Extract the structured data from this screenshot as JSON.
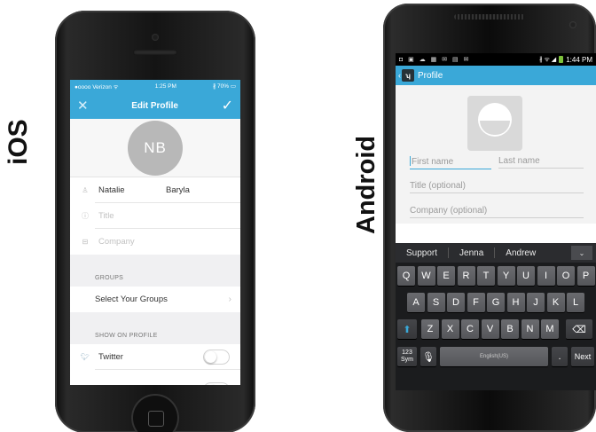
{
  "labels": {
    "ios": "iOS",
    "android": "Android"
  },
  "ios": {
    "status": {
      "carrier": "●oooo Verizon ᯤ",
      "time": "1:25 PM",
      "battery": "∦ 70% ▭"
    },
    "nav": {
      "title": "Edit Profile",
      "close_icon": "close-icon",
      "confirm_icon": "check-icon"
    },
    "avatar_initials": "NB",
    "fields": {
      "first_name": "Natalie",
      "last_name": "Baryla",
      "title_placeholder": "Title",
      "company_placeholder": "Company"
    },
    "groups": {
      "header": "GROUPS",
      "select_label": "Select Your Groups"
    },
    "show_on_profile": {
      "header": "SHOW ON PROFILE",
      "twitter_label": "Twitter",
      "twitter_enabled": false
    }
  },
  "android": {
    "status": {
      "left_icons": "◘ ▣ ☁ ▦ ✉ ▤ ✉",
      "right_icons": "∦ ᯤ ◢",
      "time": "1:44 PM"
    },
    "action_bar": {
      "title": "Profile",
      "app_icon_glyph": "ʮ"
    },
    "fields": {
      "first_name_placeholder": "First name",
      "last_name_placeholder": "Last name",
      "title_placeholder": "Title (optional)",
      "company_placeholder": "Company (optional)"
    },
    "keyboard": {
      "suggestions": [
        "Support",
        "Jenna",
        "Andrew"
      ],
      "row1": [
        "Q",
        "W",
        "E",
        "R",
        "T",
        "Y",
        "U",
        "I",
        "O",
        "P"
      ],
      "row1_hints": [
        "1",
        "2",
        "3",
        "4",
        "5",
        "6",
        "7",
        "8",
        "9",
        "0"
      ],
      "row2": [
        "A",
        "S",
        "D",
        "F",
        "G",
        "H",
        "J",
        "K",
        "L"
      ],
      "row3": [
        "Z",
        "X",
        "C",
        "V",
        "B",
        "N",
        "M"
      ],
      "sym_label": "123 Sym",
      "space_label": "English(US)",
      "period_label": ".",
      "next_label": "Next"
    }
  }
}
